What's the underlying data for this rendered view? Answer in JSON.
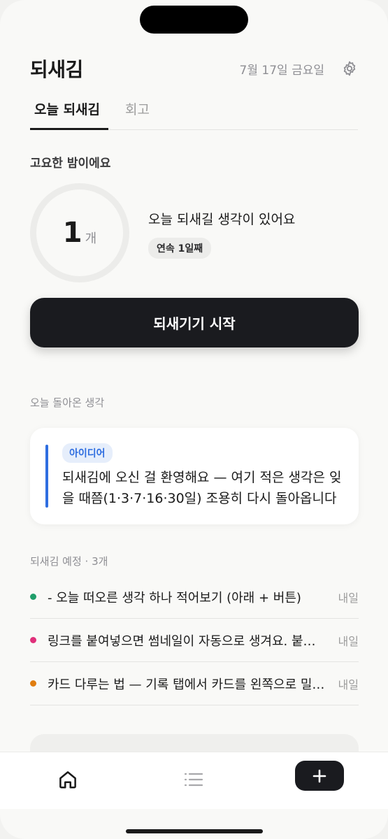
{
  "header": {
    "app_title": "되새김",
    "date": "7월 17일 금요일"
  },
  "tabs": [
    {
      "label": "오늘 되새김",
      "active": true
    },
    {
      "label": "회고",
      "active": false
    }
  ],
  "today": {
    "greeting": "고요한 밤이에요",
    "count": "1",
    "count_unit": "개",
    "summary": "오늘 되새길 생각이 있어요",
    "streak": "연속 1일째",
    "start_button": "되새기기 시작"
  },
  "returned": {
    "section_label": "오늘 돌아온 생각",
    "card": {
      "tag": "아이디어",
      "text": "되새김에 오신 걸 환영해요 — 여기 적은 생각은 잊을 때쯤(1·3·7·16·30일) 조용히 다시 돌아옵니다",
      "accent": "#2f6ee0"
    }
  },
  "upcoming": {
    "section_label": "되새김 예정 · 3개",
    "items": [
      {
        "text": "- 오늘 떠오른 생각 하나 적어보기 (아래 + 버튼)",
        "when": "내일",
        "dot_color": "#1f9e6a"
      },
      {
        "text": "링크를 붙여넣으면 썸네일이 자동으로 생겨요. 붙여넣어 보세요",
        "when": "내일",
        "dot_color": "#e0307a"
      },
      {
        "text": "카드 다루는 법 — 기록 탭에서 카드를 왼쪽으로 밀어 보세요",
        "when": "내일",
        "dot_color": "#e07d10"
      }
    ]
  },
  "icons": {
    "settings": "gear-icon",
    "home": "home-icon",
    "list": "list-icon",
    "add": "plus-icon"
  }
}
